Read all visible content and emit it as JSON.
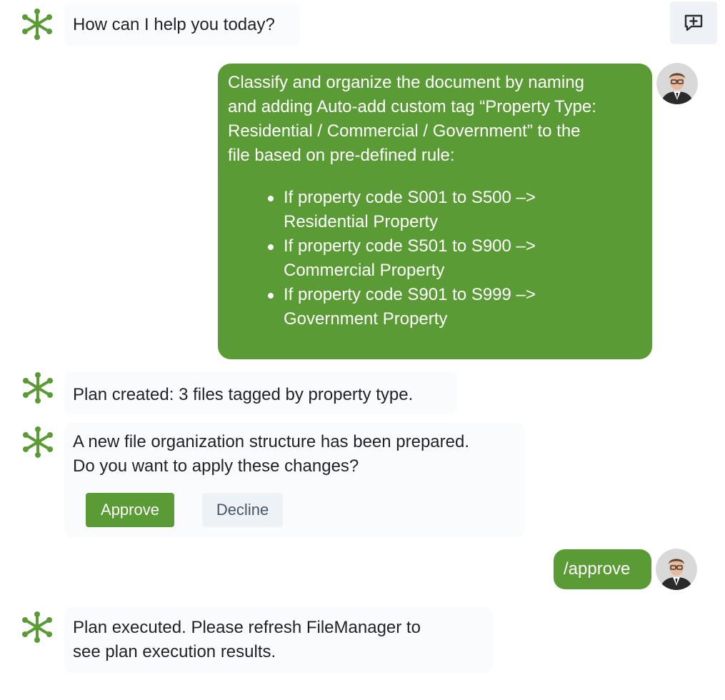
{
  "colors": {
    "accent_green": "#5b9b35",
    "bot_bubble_bg": "#fafbfc",
    "decline_bg": "#edf2f7"
  },
  "icons": {
    "bot": "bot-logo-icon",
    "new_chat": "new-chat-icon",
    "user": "user-avatar"
  },
  "header": {
    "greeting": "How can I help you today?"
  },
  "user_message_1": {
    "lines": [
      "Classify and organize the document by naming",
      "and adding Auto-add custom tag “Property Type:",
      "Residential / Commercial / Government” to the",
      "file based on pre-defined rule:"
    ],
    "rules": [
      {
        "line1": "If property code S001 to S500 –>",
        "line2": "Residential Property"
      },
      {
        "line1": "If property code S501 to S900 –>",
        "line2": "Commercial Property"
      },
      {
        "line1": "If property code S901 to S999 –>",
        "line2": "Government Property"
      }
    ]
  },
  "bot_message_plan": "Plan created: 3 files tagged by property type.",
  "bot_message_confirm": {
    "line1": "A new file organization structure has been prepared.",
    "line2": "Do you want to apply these changes?",
    "approve_label": "Approve",
    "decline_label": "Decline"
  },
  "user_message_2": "/approve",
  "bot_message_executed": {
    "line1": "Plan executed. Please refresh FileManager to",
    "line2": "see plan execution results."
  }
}
